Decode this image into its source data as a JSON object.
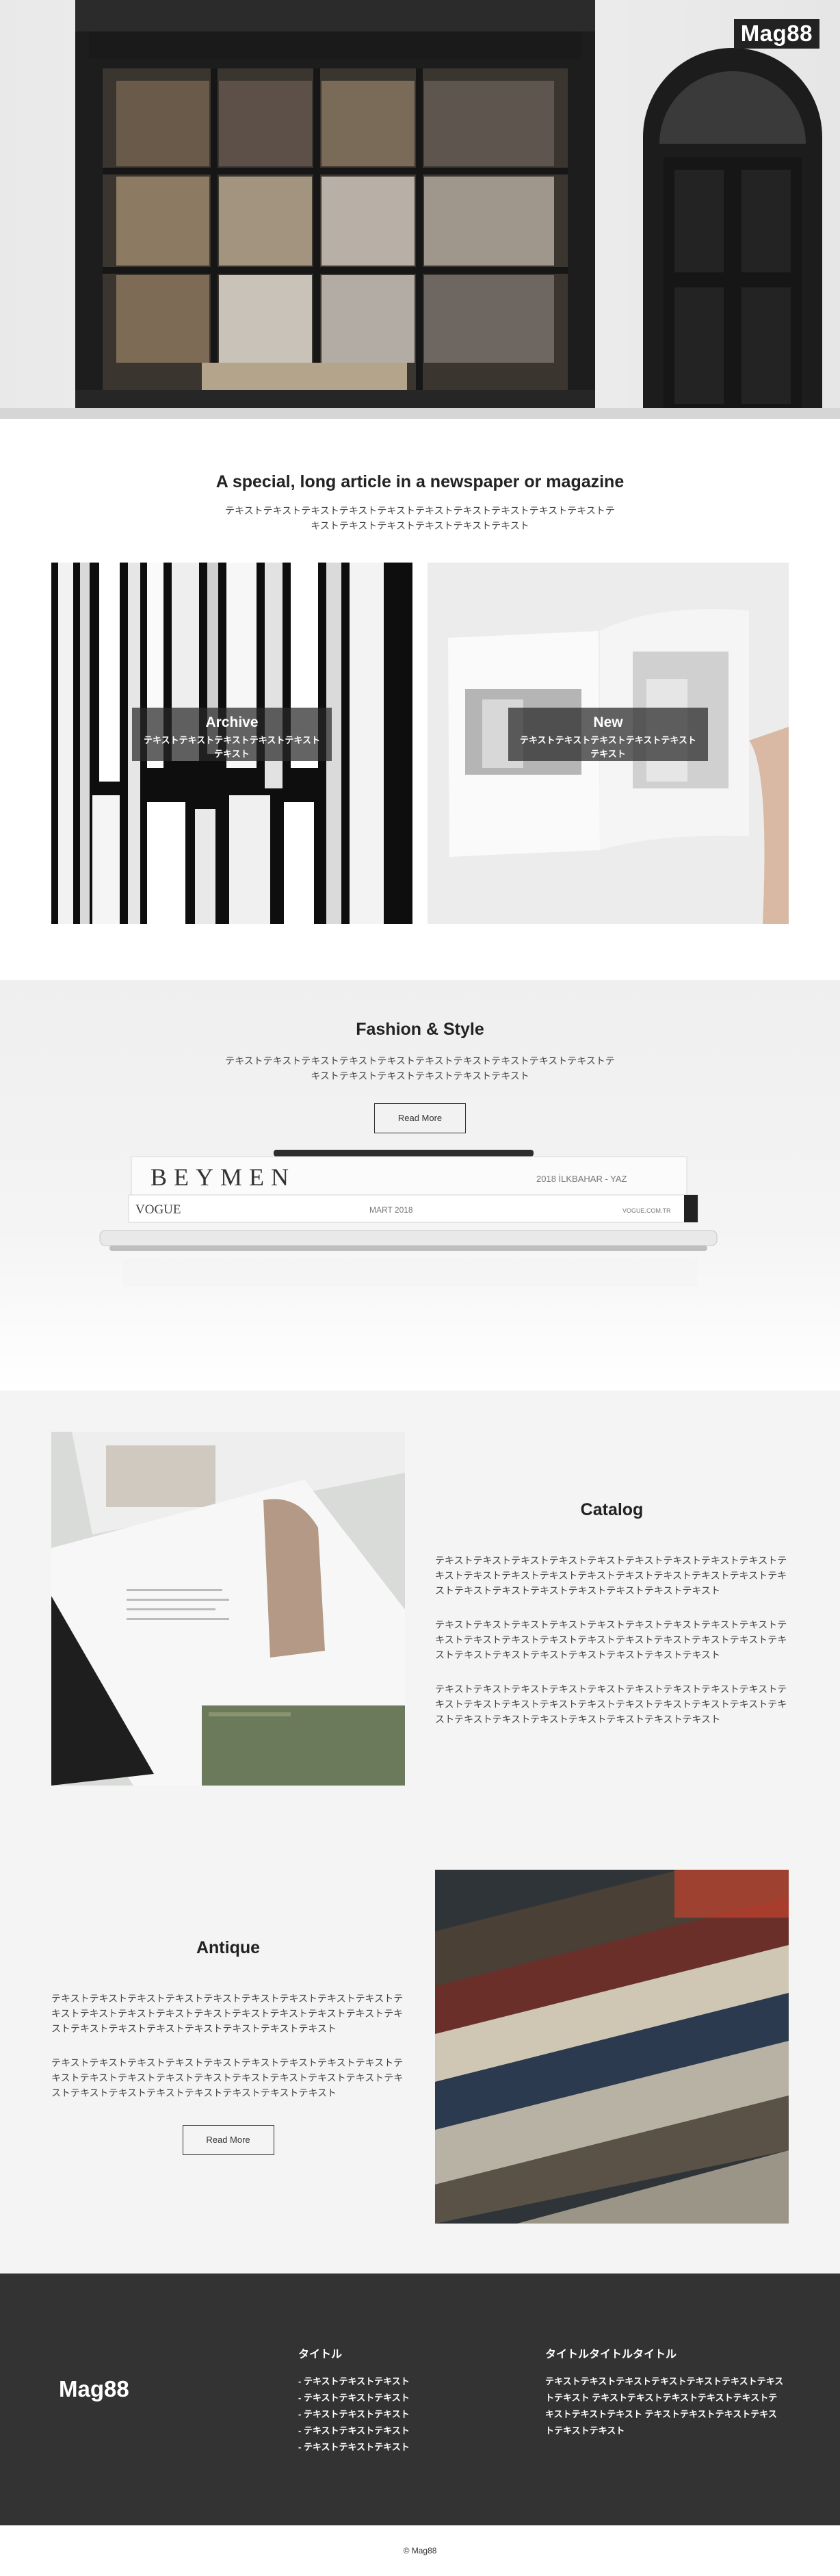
{
  "site": {
    "logo": "Mag88"
  },
  "intro": {
    "title": "A special, long article in a newspaper or magazine",
    "text": "テキストテキストテキストテキストテキストテキストテキストテキストテキストテキストテキストテキストテキストテキストテキストテキスト"
  },
  "cards": [
    {
      "title": "Archive",
      "text": "テキストテキストテキストテキストテキストテキスト"
    },
    {
      "title": "New",
      "text": "テキストテキストテキストテキストテキストテキスト"
    }
  ],
  "fashion": {
    "title": "Fashion & Style",
    "text": "テキストテキストテキストテキストテキストテキストテキストテキストテキストテキストテキストテキストテキストテキストテキストテキスト",
    "button": "Read More",
    "magazine_top": "BEYMEN",
    "magazine_top_right": "2018 İLKBAHAR - YAZ",
    "magazine_mid": "VOGUE",
    "magazine_mid_center": "MART 2018",
    "magazine_mid_right": "VOGUE.COM.TR"
  },
  "catalog": {
    "title": "Catalog",
    "paragraphs": [
      "テキストテキストテキストテキストテキストテキストテキストテキストテキストテキストテキストテキストテキストテキストテキストテキストテキストテキストテキストテキストテキストテキストテキストテキストテキストテキスト",
      "テキストテキストテキストテキストテキストテキストテキストテキストテキストテキストテキストテキストテキストテキストテキストテキストテキストテキストテキストテキストテキストテキストテキストテキストテキストテキスト",
      "テキストテキストテキストテキストテキストテキストテキストテキストテキストテキストテキストテキストテキストテキストテキストテキストテキストテキストテキストテキストテキストテキストテキストテキストテキストテキスト"
    ]
  },
  "antique": {
    "title": "Antique",
    "paragraphs": [
      "テキストテキストテキストテキストテキストテキストテキストテキストテキストテキストテキストテキストテキストテキストテキストテキストテキストテキストテキストテキストテキストテキストテキストテキストテキストテキスト",
      "テキストテキストテキストテキストテキストテキストテキストテキストテキストテキストテキストテキストテキストテキストテキストテキストテキストテキストテキストテキストテキストテキストテキストテキストテキストテキスト"
    ],
    "button": "Read More"
  },
  "footer": {
    "logo": "Mag88",
    "col1_heading": "タイトル",
    "col1_items": [
      "- テキストテキストテキスト",
      "- テキストテキストテキスト",
      "- テキストテキストテキスト",
      "- テキストテキストテキスト",
      "- テキストテキストテキスト"
    ],
    "col2_heading": "タイトルタイトルタイトル",
    "col2_text": "テキストテキストテキストテキストテキストテキストテキストテキスト テキストテキストテキストテキストテキストテキストテキストテキスト テキストテキストテキストテキストテキストテキスト"
  },
  "copyright": "© Mag88",
  "colors": {
    "dark": "#333333",
    "light_section": "#f4f4f4",
    "text": "#444444"
  }
}
